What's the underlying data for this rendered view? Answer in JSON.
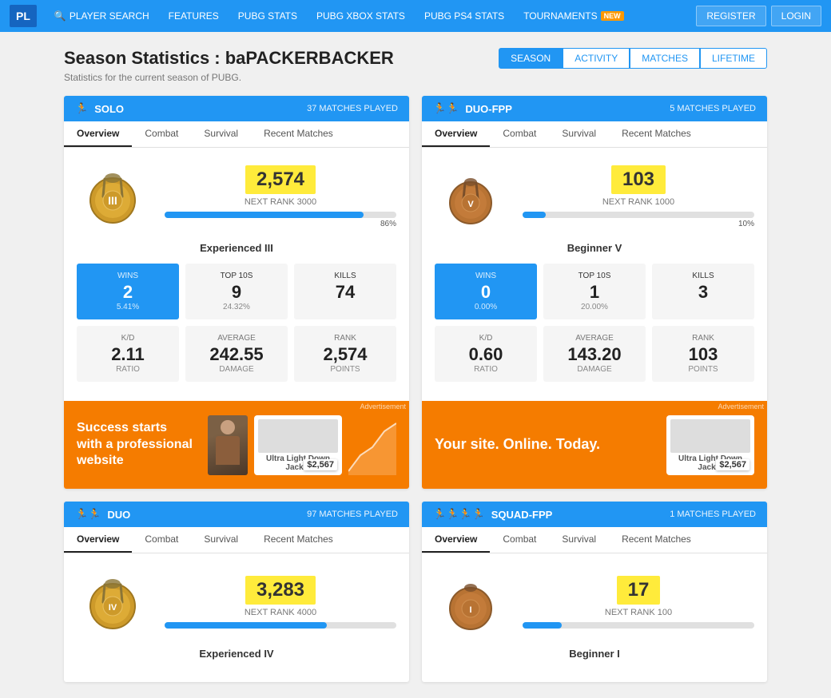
{
  "navbar": {
    "logo": "PL",
    "items": [
      {
        "label": "PLAYER SEARCH",
        "icon": "search-icon",
        "id": "player-search"
      },
      {
        "label": "FEATURES",
        "id": "features"
      },
      {
        "label": "PUBG STATS",
        "id": "pubg-stats"
      },
      {
        "label": "PUBG XBOX STATS",
        "id": "pubg-xbox-stats"
      },
      {
        "label": "PUBG PS4 STATS",
        "id": "pubg-ps4-stats"
      },
      {
        "label": "TOURNAMENTS",
        "id": "tournaments",
        "badge": "NEW"
      }
    ],
    "register": "REGISTER",
    "login": "LOGIN"
  },
  "page": {
    "title": "Season Statistics : baPACKERBACKER",
    "subtitle": "Statistics for the current season of PUBG.",
    "view_tabs": [
      "SEASON",
      "ACTIVITY",
      "MATCHES",
      "LIFETIME"
    ]
  },
  "sections": [
    {
      "id": "solo",
      "title": "SOLO",
      "matches_played": "37 MATCHES PLAYED",
      "inner_tabs": [
        "Overview",
        "Combat",
        "Survival",
        "Recent Matches"
      ],
      "rank_score": "2,574",
      "next_rank_label": "NEXT RANK 3000",
      "rank_bar_pct": 86,
      "rank_bar_pct_label": "86%",
      "rank_name": "Experienced III",
      "wins": "2",
      "wins_pct": "5.41%",
      "top10s": "9",
      "top10s_pct": "24.32%",
      "kills": "74",
      "kd_ratio": "2.11",
      "average_damage": "242.55",
      "rank_points": "2,574",
      "ad_text": "Success starts with a professional website",
      "ad_price": "$2,567"
    },
    {
      "id": "duo-fpp",
      "title": "DUO-FPP",
      "matches_played": "5 MATCHES PLAYED",
      "inner_tabs": [
        "Overview",
        "Combat",
        "Survival",
        "Recent Matches"
      ],
      "rank_score": "103",
      "next_rank_label": "NEXT RANK 1000",
      "rank_bar_pct": 10,
      "rank_bar_pct_label": "10%",
      "rank_name": "Beginner V",
      "wins": "0",
      "wins_pct": "0.00%",
      "top10s": "1",
      "top10s_pct": "20.00%",
      "kills": "3",
      "kd_ratio": "0.60",
      "average_damage": "143.20",
      "rank_points": "103",
      "ad_text": "Your site. Online. Today.",
      "ad_price": "$2,567"
    },
    {
      "id": "duo",
      "title": "DUO",
      "matches_played": "97 MATCHES PLAYED",
      "inner_tabs": [
        "Overview",
        "Combat",
        "Survival",
        "Recent Matches"
      ],
      "rank_score": "3,283",
      "next_rank_label": "NEXT RANK 4000",
      "rank_bar_pct": 70,
      "rank_bar_pct_label": "70%",
      "rank_name": "Experienced IV"
    },
    {
      "id": "squad-fpp",
      "title": "SQUAD-FPP",
      "matches_played": "1 MATCHES PLAYED",
      "inner_tabs": [
        "Overview",
        "Combat",
        "Survival",
        "Recent Matches"
      ],
      "rank_score": "17",
      "next_rank_label": "NEXT RANK 100",
      "rank_bar_pct": 17,
      "rank_bar_pct_label": "17%",
      "rank_name": "Beginner I"
    }
  ],
  "labels": {
    "wins": "WINS",
    "top10s": "TOP 10S",
    "kills": "KILLS",
    "kd_ratio": "K/D",
    "ratio": "RATIO",
    "average": "AVERAGE",
    "damage": "DAMAGE",
    "rank": "RANK",
    "points": "POINTS",
    "ad_label": "Advertisement"
  }
}
